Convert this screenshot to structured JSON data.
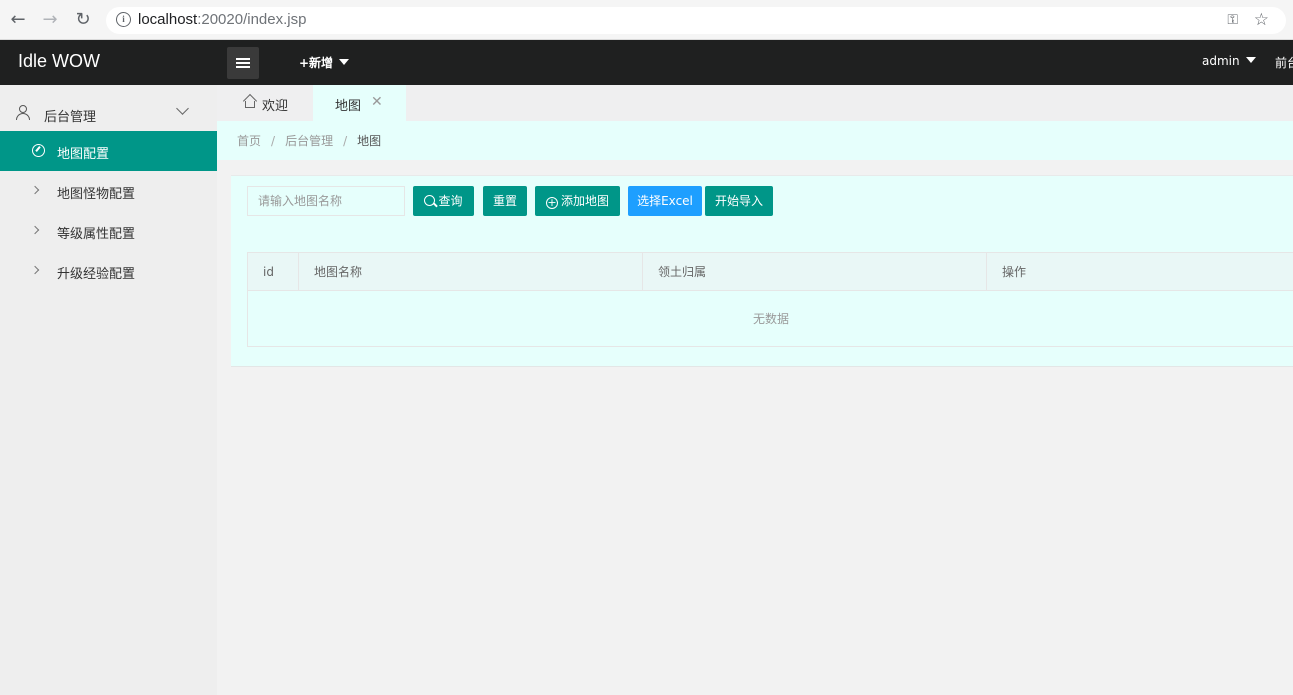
{
  "browser": {
    "url_host": "localhost",
    "url_rest": ":20020/index.jsp",
    "icons": [
      "back-arrow-icon",
      "forward-arrow-icon",
      "reload-icon",
      "info-icon",
      "key-icon",
      "star-icon"
    ]
  },
  "header": {
    "logo": "Idle WOW",
    "new_label": "+新增",
    "user_label": "admin",
    "front_label": "前台"
  },
  "sidebar": {
    "group_label": "后台管理",
    "items": [
      {
        "label": "地图配置",
        "active": true
      },
      {
        "label": "地图怪物配置",
        "active": false
      },
      {
        "label": "等级属性配置",
        "active": false
      },
      {
        "label": "升级经验配置",
        "active": false
      }
    ]
  },
  "tabs": [
    {
      "label": "欢迎"
    },
    {
      "label": "地图",
      "active": true
    }
  ],
  "breadcrumb": {
    "home": "首页",
    "parent": "后台管理",
    "current": "地图",
    "separator": "/"
  },
  "toolbar": {
    "search_placeholder": "请输入地图名称",
    "query_label": "查询",
    "reset_label": "重置",
    "add_label": "添加地图",
    "select_excel_label": "选择Excel",
    "import_label": "开始导入"
  },
  "table": {
    "columns": [
      "id",
      "地图名称",
      "领土归属",
      "操作"
    ],
    "empty_text": "无数据"
  },
  "colors": {
    "primary": "#009688",
    "blue": "#1e9fff",
    "header_bg": "#1f2020",
    "content_bg": "#e6fffc"
  }
}
